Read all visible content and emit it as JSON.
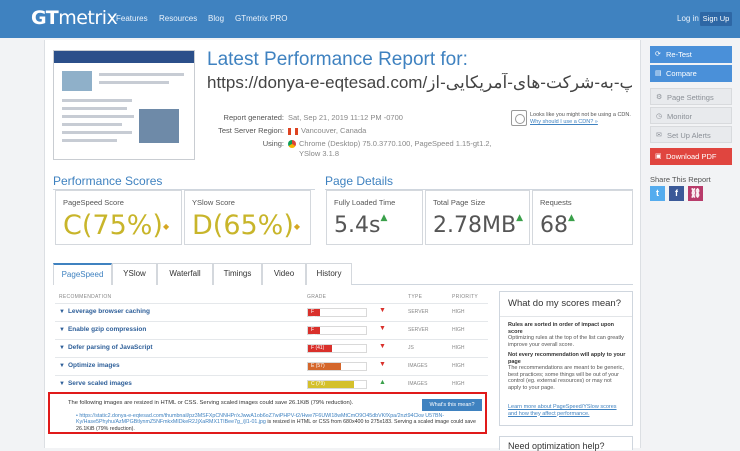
{
  "nav": {
    "logo_bold": "GT",
    "logo_rest": "metrix",
    "links": [
      "Features",
      "Resources",
      "Blog",
      "GTmetrix PRO"
    ],
    "login": "Log in",
    "signup": "Sign Up"
  },
  "report": {
    "title": "Latest Performance Report for:",
    "url": "https://donya-e-eqtesad.com/فرمان-ترامپ-به-شرکت-های-آمریکایی-از…",
    "generated_label": "Report generated:",
    "generated_value": "Sat, Sep 21, 2019 11:12 PM -0700",
    "region_label": "Test Server Region:",
    "region_value": "Vancouver, Canada",
    "using_label": "Using:",
    "using_value_1": "Chrome (Desktop) 75.0.3770.100, PageSpeed 1.15-gt1.2,",
    "using_value_2": "YSlow 3.1.8",
    "cdn_text": "Looks like you might not be using a CDN.",
    "cdn_link": "Why should I use a CDN? »"
  },
  "scores": {
    "title": "Performance Scores",
    "pagespeed_label": "PageSpeed Score",
    "pagespeed_grade": "C",
    "pagespeed_pct": "(75%)",
    "yslow_label": "YSlow Score",
    "yslow_grade": "D",
    "yslow_pct": "(65%)"
  },
  "details": {
    "title": "Page Details",
    "load_label": "Fully Loaded Time",
    "load_value": "5.4s",
    "size_label": "Total Page Size",
    "size_value": "2.78MB",
    "req_label": "Requests",
    "req_value": "68"
  },
  "tabs": [
    "PageSpeed",
    "YSlow",
    "Waterfall",
    "Timings",
    "Video",
    "History"
  ],
  "table": {
    "headers": [
      "RECOMMENDATION",
      "GRADE",
      "TYPE",
      "PRIORITY"
    ],
    "rows": [
      {
        "name": "Leverage browser caching",
        "grade": "F (0)",
        "pct": 0.08,
        "color": "#d9302b",
        "type": "SERVER",
        "priority": "HIGH",
        "trend": "▼"
      },
      {
        "name": "Enable gzip compression",
        "grade": "F (0)",
        "pct": 0.08,
        "color": "#d9302b",
        "type": "SERVER",
        "priority": "HIGH",
        "trend": "▼"
      },
      {
        "name": "Defer parsing of JavaScript",
        "grade": "F (41)",
        "pct": 0.41,
        "color": "#d9302b",
        "type": "JS",
        "priority": "HIGH",
        "trend": "▼"
      },
      {
        "name": "Optimize images",
        "grade": "E (57)",
        "pct": 0.57,
        "color": "#d4662b",
        "type": "IMAGES",
        "priority": "HIGH",
        "trend": "▼"
      },
      {
        "name": "Serve scaled images",
        "grade": "C (79)",
        "pct": 0.79,
        "color": "#d4c02b",
        "type": "IMAGES",
        "priority": "HIGH",
        "trend": "▲"
      }
    ]
  },
  "alert": {
    "message": "The following images are resized in HTML or CSS. Serving scaled images could save 26.1KiB (79% reduction).",
    "button": "What's this mean?",
    "link": "https://static2.donya-e-eqtesad.com/thumbnail/pz3MSFXpCNNHPr/xJwwA1ob6oZ7wiPHPV-t2/Hwe7F6UWl18wMtCmO9O45dbVKfXpa/2nzt94Ckw U57BN-Ky/Hase5Phyhu/AzMPGBtlynmZ5NFmkxMIDkeR2JjXaRMX1TIBee7g_/jl1-01.jpg",
    "rest": "is resized in HTML or CSS from 680x400 to 275x183. Serving a scaled image could save 26.1KiB (79% reduction)."
  },
  "help": {
    "title": "What do my scores mean?",
    "p1_bold": "Rules are sorted in order of impact upon score",
    "p1": "Optimizing rules at the top of the list can greatly improve your overall score.",
    "p2_bold": "Not every recommendation will apply to your page",
    "p2": "The recommendations are meant to be generic, best practices; some things will be out of your control (eg. external resources) or may not apply to your page.",
    "link": "Learn more about PageSpeed/YSlow scores and how they affect performance.",
    "next_title": "Need optimization help?"
  },
  "sidebar": {
    "retest": "Re-Test",
    "compare": "Compare",
    "settings": "Page Settings",
    "monitor": "Monitor",
    "alerts": "Set Up Alerts",
    "pdf": "Download PDF",
    "share": "Share This Report"
  },
  "colors": {
    "brand": "#3f82c0",
    "alert_border": "#e01a1a",
    "pdf": "#e0453f"
  }
}
